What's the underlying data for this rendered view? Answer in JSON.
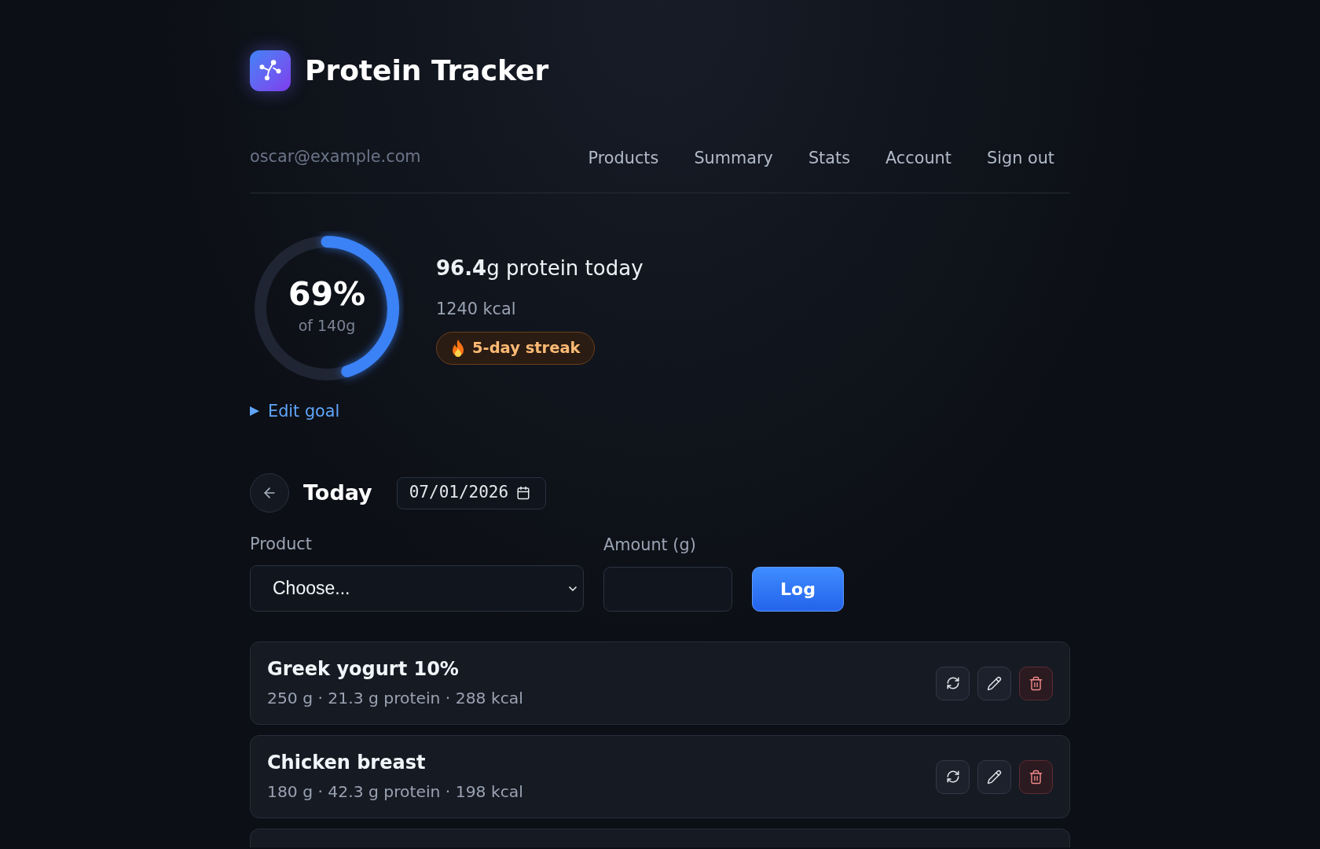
{
  "app": {
    "title": "Protein Tracker"
  },
  "nav": {
    "email": "oscar@example.com",
    "links": [
      "Products",
      "Summary",
      "Stats",
      "Account",
      "Sign out"
    ]
  },
  "progress": {
    "percent": "69%",
    "goal": "of 140g",
    "level": 0.45,
    "protein_today": "**96.4**g protein today",
    "kcal": "1240 kcal",
    "streak": "5-day streak"
  },
  "edit_goal": {
    "label": "Edit goal",
    "expanded": false
  },
  "day": {
    "title": "Today",
    "date": "07/01/2026"
  },
  "form": {
    "product_label": "Product",
    "product_value": "Choose...",
    "amount_label": "Amount (g)",
    "submit_label": "Log"
  },
  "entries": [
    {
      "name": "Greek yogurt 10%",
      "details": "250 g · 21.3 g protein · 288 kcal"
    },
    {
      "name": "Chicken breast",
      "details": "180 g · 42.3 g protein · 198 kcal"
    }
  ]
}
